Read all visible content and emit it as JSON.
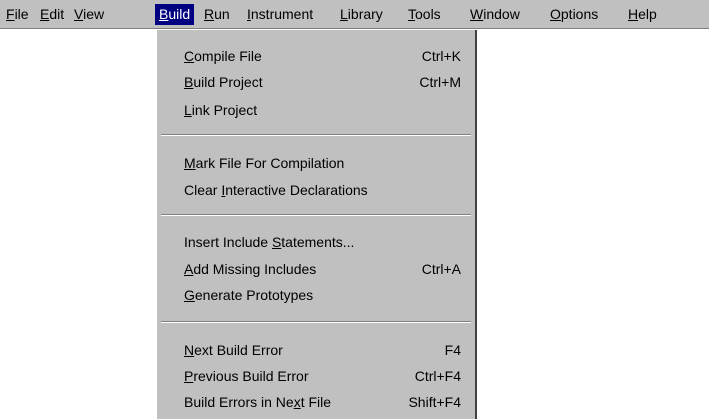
{
  "menubar": {
    "items": [
      {
        "label": "File",
        "u": "F",
        "rest": "ile"
      },
      {
        "label": "Edit",
        "u": "E",
        "rest": "dit"
      },
      {
        "label": "View",
        "u": "V",
        "rest": "iew"
      },
      {
        "label": "Build",
        "u": "B",
        "rest": "uild",
        "active": true
      },
      {
        "label": "Run",
        "u": "R",
        "rest": "un"
      },
      {
        "label": "Instrument",
        "u": "I",
        "rest": "nstrument"
      },
      {
        "label": "Library",
        "u": "L",
        "rest": "ibrary"
      },
      {
        "label": "Tools",
        "u": "T",
        "rest": "ools"
      },
      {
        "label": "Window",
        "u": "W",
        "rest": "indow"
      },
      {
        "label": "Options",
        "u": "O",
        "rest": "ptions"
      },
      {
        "label": "Help",
        "u": "H",
        "rest": "elp"
      }
    ]
  },
  "build_menu": {
    "compile_file": {
      "pre": "",
      "u": "C",
      "post": "ompile File",
      "shortcut": "Ctrl+K"
    },
    "build_project": {
      "pre": "",
      "u": "B",
      "post": "uild Project",
      "shortcut": "Ctrl+M"
    },
    "link_project": {
      "pre": "",
      "u": "L",
      "post": "ink Project",
      "shortcut": ""
    },
    "mark_file": {
      "pre": "",
      "u": "M",
      "post": "ark File For Compilation",
      "shortcut": ""
    },
    "clear_decl": {
      "pre": "Clear ",
      "u": "I",
      "post": "nteractive Declarations",
      "shortcut": ""
    },
    "insert_include": {
      "pre": "Insert Include ",
      "u": "S",
      "post": "tatements...",
      "shortcut": ""
    },
    "add_missing": {
      "pre": "",
      "u": "A",
      "post": "dd Missing Includes",
      "shortcut": "Ctrl+A"
    },
    "generate_proto": {
      "pre": "",
      "u": "G",
      "post": "enerate Prototypes",
      "shortcut": ""
    },
    "next_error": {
      "pre": "",
      "u": "N",
      "post": "ext Build Error",
      "shortcut": "F4"
    },
    "prev_error": {
      "pre": "",
      "u": "P",
      "post": "revious Build Error",
      "shortcut": "Ctrl+F4"
    },
    "errors_next_file": {
      "pre": "Build Errors in Ne",
      "u": "x",
      "post": "t File",
      "shortcut": "Shift+F4"
    }
  },
  "colors": {
    "menu_bg": "#c0c0c0",
    "highlight": "#000080"
  }
}
